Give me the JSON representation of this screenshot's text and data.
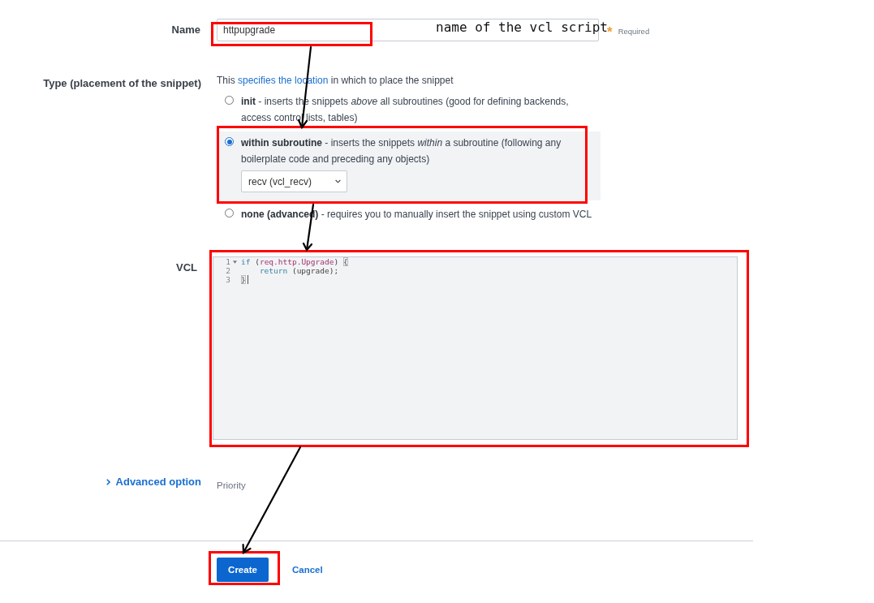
{
  "annotation": {
    "note": "name of the vcl script"
  },
  "name_field": {
    "label": "Name",
    "value": "httpupgrade",
    "required_mark": "*",
    "required_text": "Required"
  },
  "type_field": {
    "label": "Type (placement of the snippet)",
    "description": {
      "before": "This",
      "link": "specifies the location",
      "after": "in which to place the snippet"
    },
    "options": [
      {
        "text": "**init** - inserts the snippets *above* all subroutines (good for defining backends, access control lists, tables)",
        "selected": false
      },
      {
        "text": "**within subroutine** - inserts the snippets *within* a subroutine (following any boilerplate code and preceding any objects)",
        "selected": true,
        "subroutine_select": "recv (vcl_recv)"
      },
      {
        "text": "**none (advanced)** - requires you to manually insert the snippet using custom VCL",
        "selected": false
      }
    ]
  },
  "vcl_field": {
    "label": "VCL",
    "lines": [
      {
        "number": "1",
        "foldable": true,
        "cursor": false,
        "tokens": [
          {
            "text": "if",
            "kind": "keyword"
          },
          {
            "text": " (",
            "kind": "plain"
          },
          {
            "text": "req.http.Upgrade",
            "kind": "variable"
          },
          {
            "text": ") ",
            "kind": "plain"
          },
          {
            "text": "{",
            "kind": "bracket"
          }
        ]
      },
      {
        "number": "2",
        "foldable": false,
        "cursor": false,
        "tokens": [
          {
            "text": "    return",
            "kind": "keyword"
          },
          {
            "text": " (upgrade);",
            "kind": "plain"
          }
        ]
      },
      {
        "number": "3",
        "foldable": false,
        "cursor": true,
        "tokens": [
          {
            "text": "}",
            "kind": "bracket"
          }
        ]
      }
    ]
  },
  "advanced": {
    "label": "Advanced option",
    "expanded": false,
    "priority_label": "Priority"
  },
  "buttons": [
    {
      "label": "Create",
      "kind": "primary"
    },
    {
      "label": "Cancel",
      "kind": "link"
    }
  ]
}
